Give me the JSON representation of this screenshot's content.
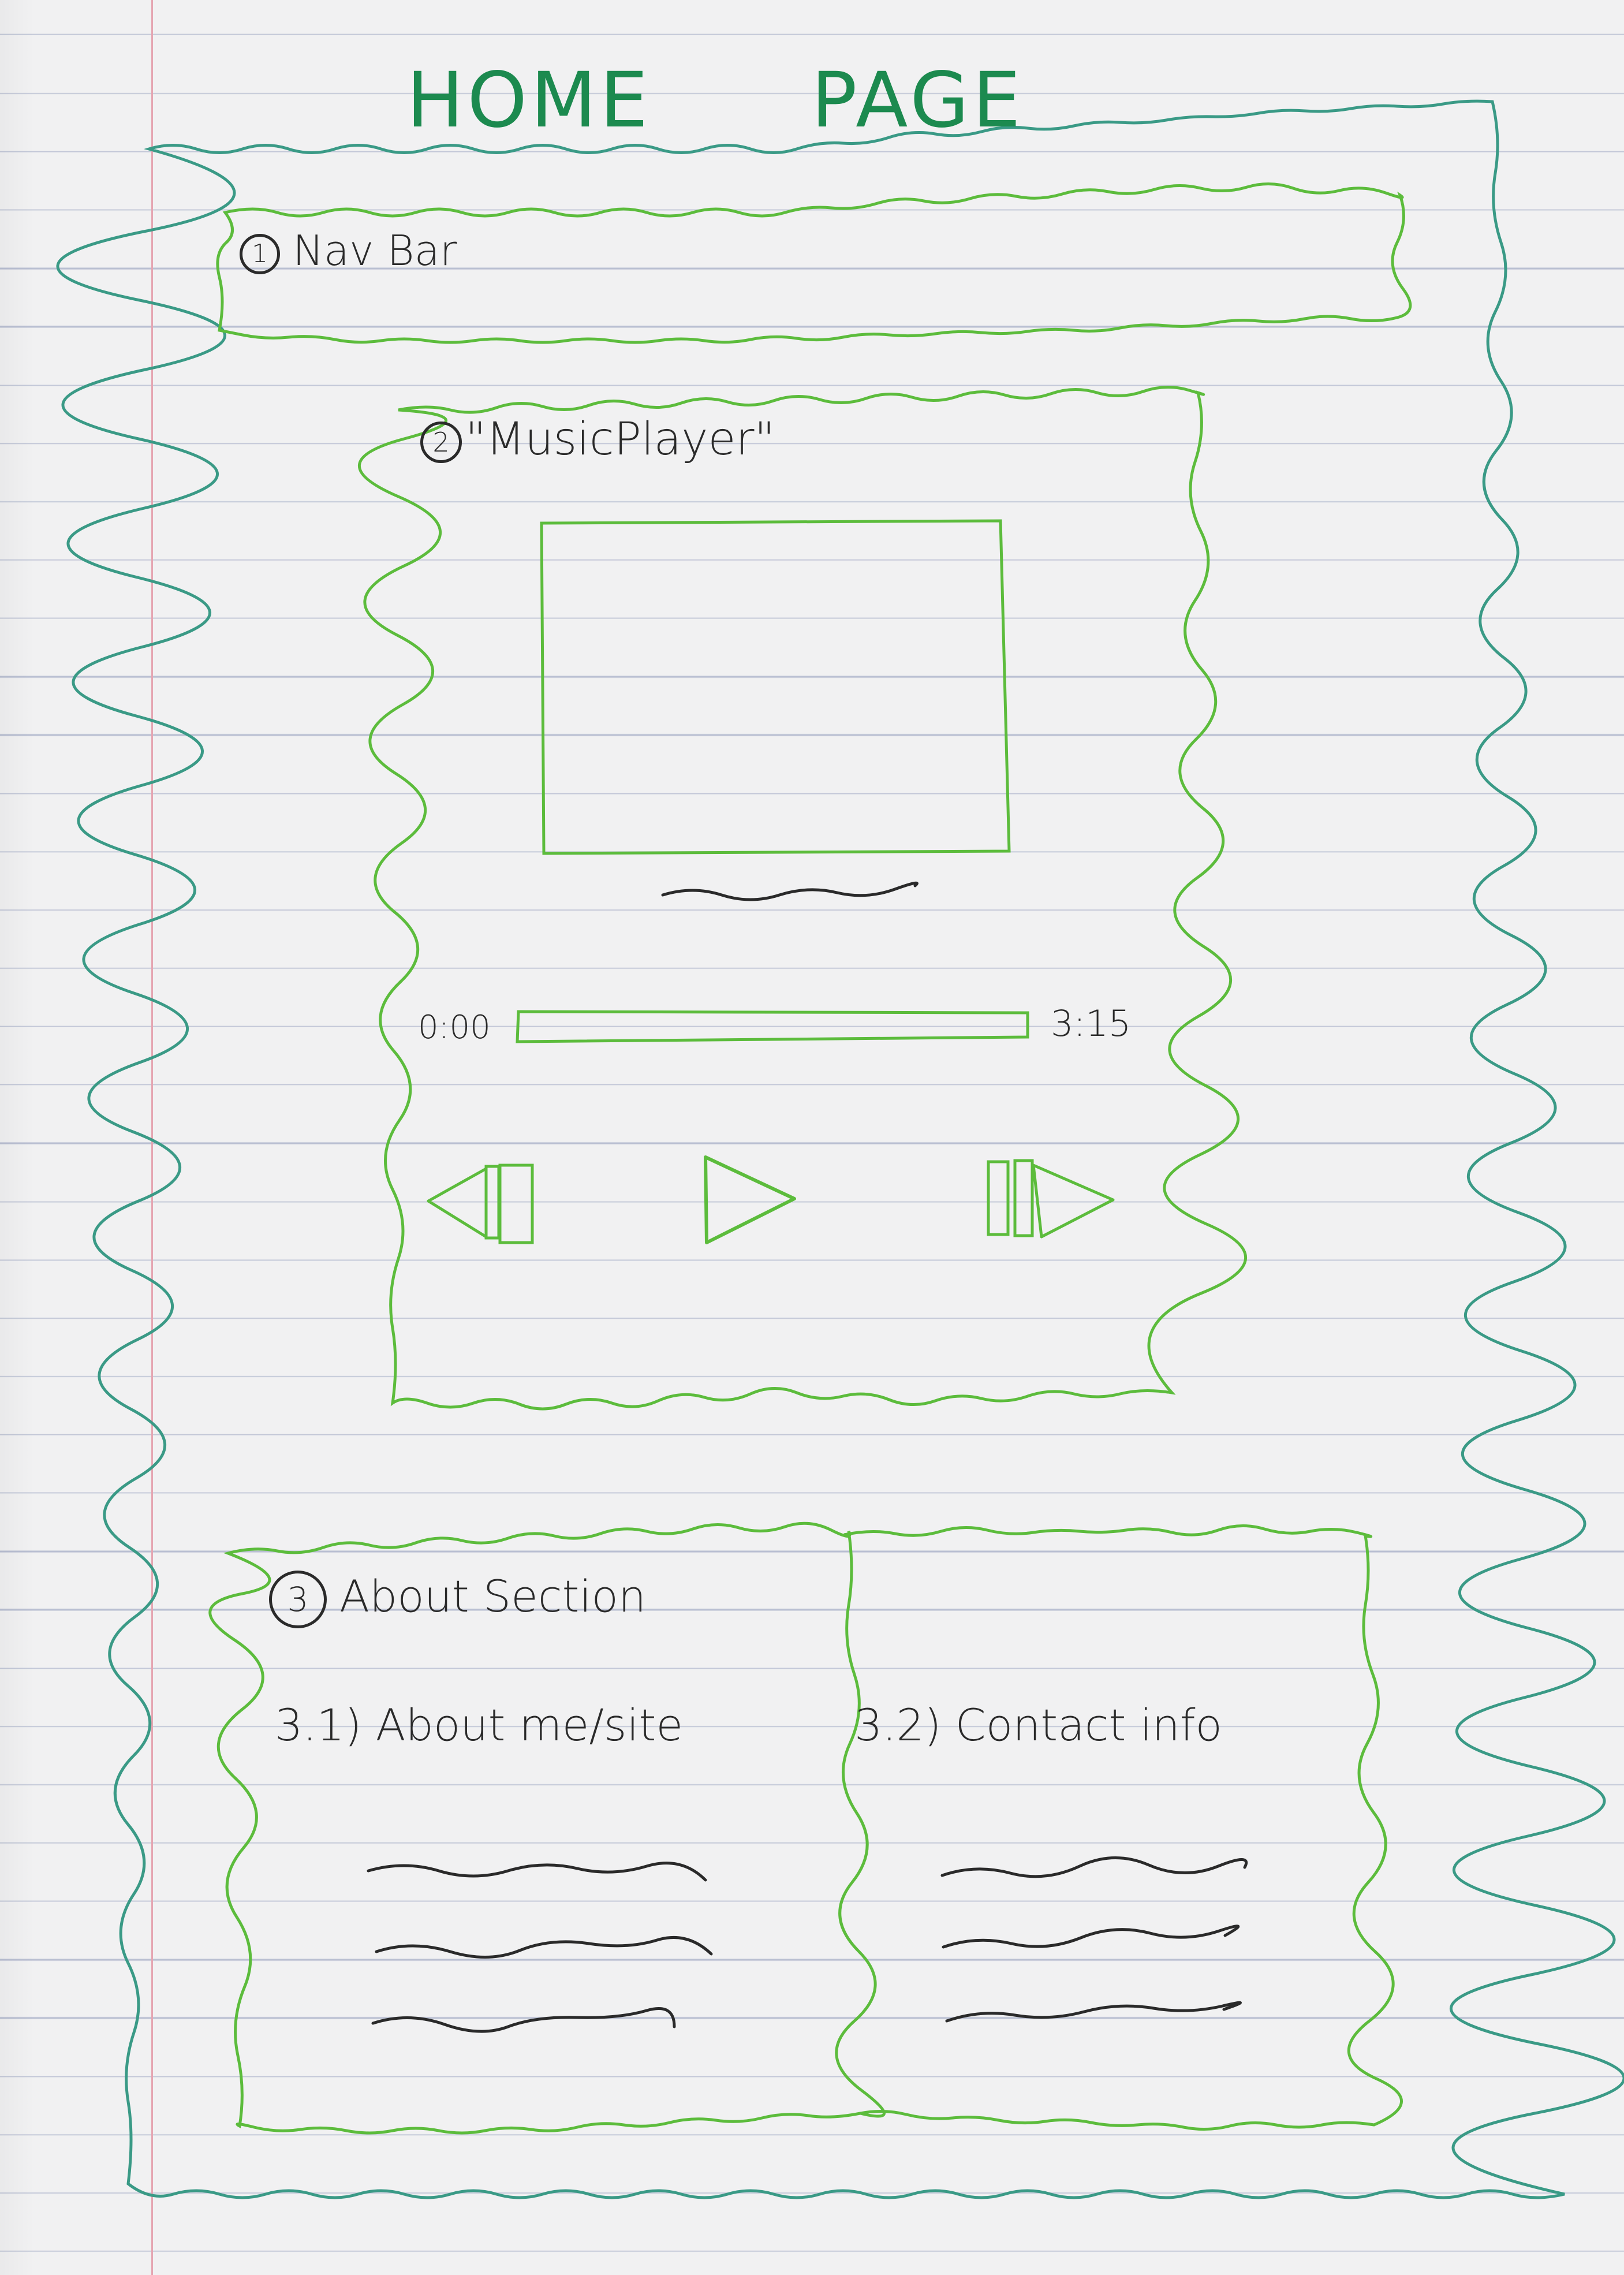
{
  "page": {
    "title_left": "HOME",
    "title_right": "PAGE"
  },
  "navbar": {
    "number": "1",
    "label": "Nav Bar"
  },
  "music_player": {
    "number": "2",
    "label": "\"MusicPlayer\"",
    "time_start": "0:00",
    "time_end": "3:15",
    "progress": 0,
    "controls": [
      "previous-icon",
      "play-icon",
      "next-icon"
    ]
  },
  "about": {
    "number": "3",
    "label": "About Section",
    "about_me": {
      "label": "3.1) About me/site"
    },
    "contact": {
      "label": "3.2) Contact info"
    }
  },
  "colors": {
    "title": "#1c8a4f",
    "sketch_green": "#5cbc3c",
    "outer_border": "#3a9a86",
    "ink": "#2a2a2a"
  }
}
